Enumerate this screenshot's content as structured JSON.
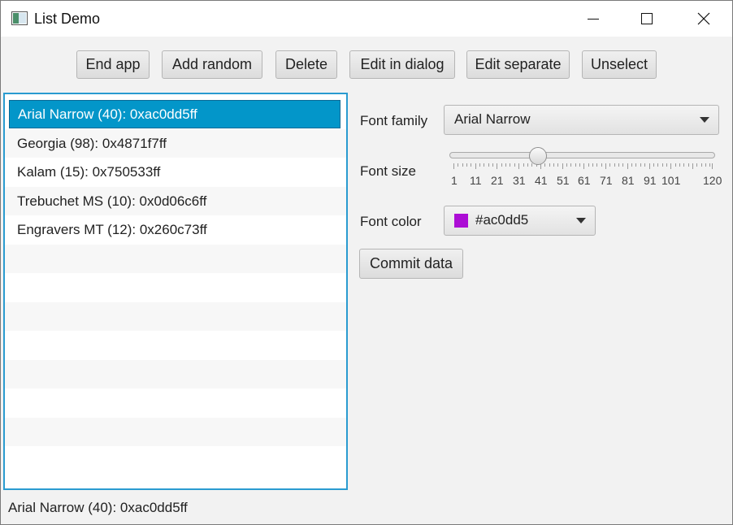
{
  "window": {
    "title": "List Demo"
  },
  "toolbar": {
    "end_app": "End app",
    "add_random": "Add random",
    "delete": "Delete",
    "edit_dialog": "Edit in dialog",
    "edit_separate": "Edit separate",
    "unselect": "Unselect"
  },
  "list": {
    "items": [
      "Arial Narrow (40): 0xac0dd5ff",
      "Georgia (98): 0x4871f7ff",
      "Kalam (15): 0x750533ff",
      "Trebuchet MS (10): 0x0d06c6ff",
      "Engravers MT (12): 0x260c73ff"
    ],
    "selected_index": 0
  },
  "form": {
    "font_family_label": "Font family",
    "font_family_value": "Arial Narrow",
    "font_size_label": "Font size",
    "font_size_value": 40,
    "slider_min": 1,
    "slider_max": 120,
    "tick_labels": [
      "1",
      "11",
      "21",
      "31",
      "41",
      "51",
      "61",
      "71",
      "81",
      "91",
      "101",
      "120"
    ],
    "font_color_label": "Font color",
    "font_color_value": "#ac0dd5",
    "commit_label": "Commit data"
  },
  "colors": {
    "selection": "#0396c9",
    "list_border": "#2a9bd0",
    "swatch": "#ac0dd5"
  },
  "status": {
    "text": "Arial Narrow (40): 0xac0dd5ff"
  }
}
